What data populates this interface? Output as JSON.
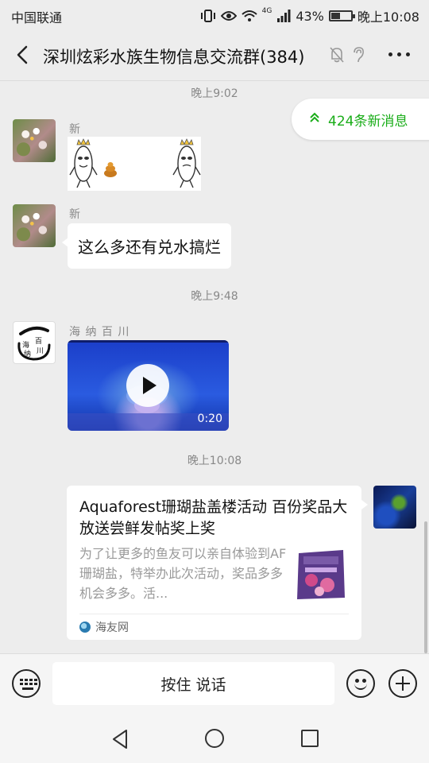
{
  "status_bar": {
    "carrier": "中国联通",
    "battery": "43%",
    "battery_level": 0.43,
    "time": "晚上10:08",
    "network_label": "4G"
  },
  "header": {
    "title": "深圳炫彩水族生物信息交流群(384)"
  },
  "new_messages": {
    "label": "424条新消息"
  },
  "timestamps": [
    "晚上9:02",
    "晚上9:48",
    "晚上10:08"
  ],
  "messages": [
    {
      "sender": "新",
      "type": "sticker"
    },
    {
      "sender": "新",
      "type": "text",
      "text": "这么多还有兑水搞烂"
    },
    {
      "sender": "海 纳 百 川",
      "type": "video",
      "duration": "0:20",
      "avatar_text": "海纳百川"
    },
    {
      "type": "link",
      "title": "Aquaforest珊瑚盐盖楼活动 百份奖品大放送尝鲜发帖奖上奖",
      "description": "为了让更多的鱼友可以亲自体验到AF珊瑚盐，特举办此次活动，奖品多多机会多多。活...",
      "source": "海友网"
    }
  ],
  "input_bar": {
    "hold_to_talk": "按住 说话"
  },
  "colors": {
    "accent_green": "#1aad19",
    "background": "#ededed"
  }
}
